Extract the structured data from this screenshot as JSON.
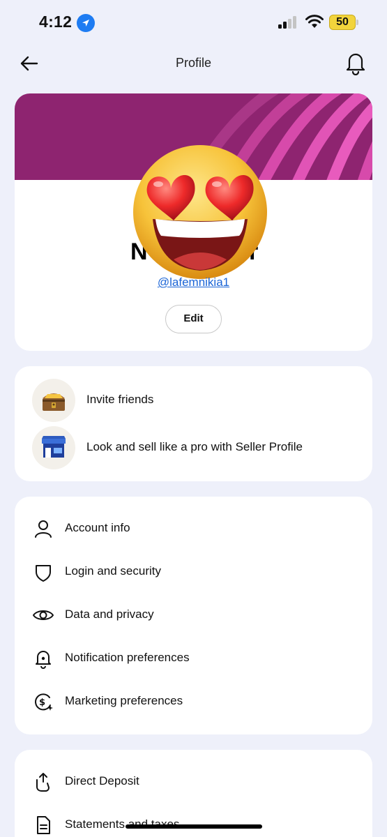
{
  "status_bar": {
    "time": "4:12",
    "battery": "50"
  },
  "header": {
    "title": "Profile"
  },
  "profile": {
    "name_partial_left": "N",
    "name_partial_right": "r",
    "username": "@lafemnikia1",
    "edit_label": "Edit"
  },
  "promos": [
    {
      "label": "Invite friends",
      "icon": "treasure-chest-icon"
    },
    {
      "label": "Look and sell like a pro with Seller Profile",
      "icon": "storefront-icon"
    }
  ],
  "settings": [
    {
      "label": "Account info",
      "icon": "person-icon"
    },
    {
      "label": "Login and security",
      "icon": "shield-icon"
    },
    {
      "label": "Data and privacy",
      "icon": "eye-icon"
    },
    {
      "label": "Notification preferences",
      "icon": "bell-gear-icon"
    },
    {
      "label": "Marketing preferences",
      "icon": "dollar-sparkle-icon"
    }
  ],
  "finance": [
    {
      "label": "Direct Deposit",
      "icon": "deposit-hand-icon"
    },
    {
      "label": "Statements and taxes",
      "icon": "document-icon"
    }
  ],
  "colors": {
    "banner": "#8e2470",
    "accent_link": "#1a64d6",
    "background": "#eef0fa"
  }
}
